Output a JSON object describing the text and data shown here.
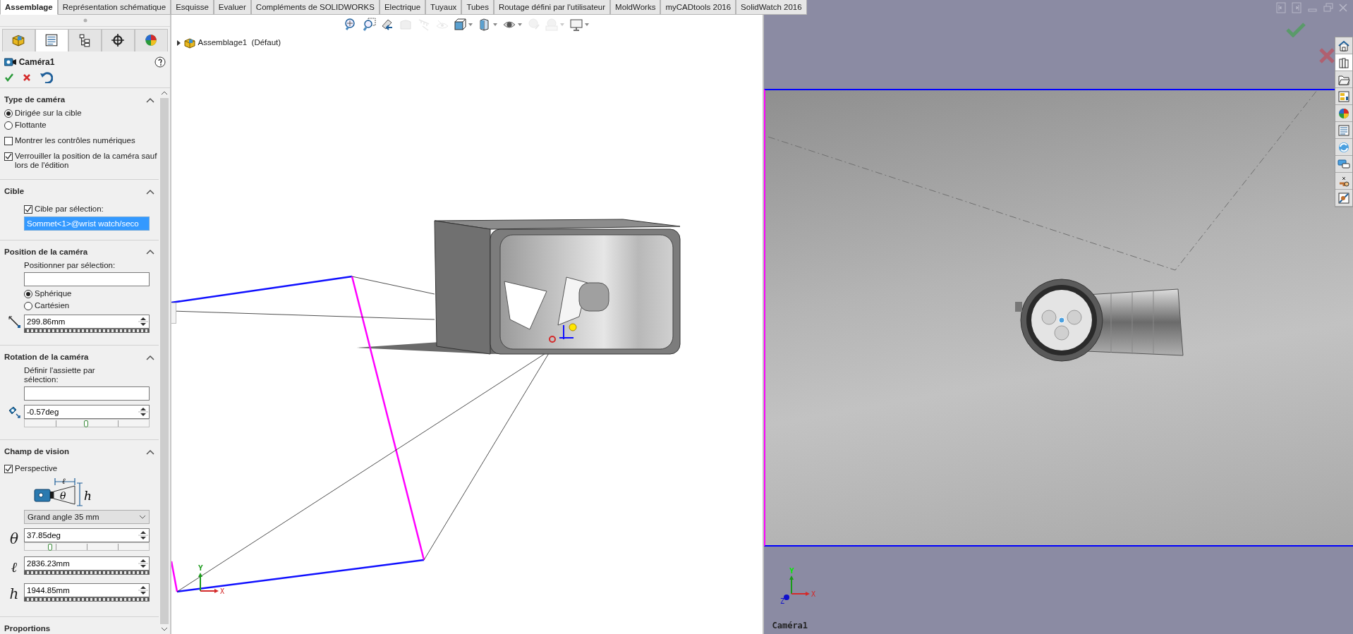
{
  "command_tabs": [
    {
      "label": "Assemblage",
      "selected": true
    },
    {
      "label": "Représentation schématique",
      "selected": false
    },
    {
      "label": "Esquisse",
      "selected": false
    },
    {
      "label": "Evaluer",
      "selected": false
    },
    {
      "label": "Compléments de SOLIDWORKS",
      "selected": false
    },
    {
      "label": "Electrique",
      "selected": false
    },
    {
      "label": "Tuyaux",
      "selected": false
    },
    {
      "label": "Tubes",
      "selected": false
    },
    {
      "label": "Routage défini par l'utilisateur",
      "selected": false
    },
    {
      "label": "MoldWorks",
      "selected": false
    },
    {
      "label": "myCADtools 2016",
      "selected": false
    },
    {
      "label": "SolidWatch 2016",
      "selected": false
    }
  ],
  "panel_tabs": [
    {
      "kind": "part",
      "selected": false
    },
    {
      "kind": "properties",
      "selected": true
    },
    {
      "kind": "config",
      "selected": false
    },
    {
      "kind": "target",
      "selected": false
    },
    {
      "kind": "appearance",
      "selected": false
    }
  ],
  "property_manager": {
    "title": "Caméra1",
    "sections": [
      {
        "title": "Type de caméra",
        "expanded": true,
        "items": [
          {
            "kind": "radio",
            "label": "Dirigée sur la cible",
            "selected": true,
            "indented": false
          },
          {
            "kind": "radio",
            "label": "Flottante",
            "selected": false,
            "indented": false
          },
          {
            "kind": "checkbox",
            "label": "Montrer les contrôles numériques",
            "checked": false,
            "indented": false
          },
          {
            "kind": "checkbox",
            "label": "Verrouiller la position de la caméra sauf lors de l'édition",
            "checked": true,
            "indented": false
          }
        ]
      },
      {
        "title": "Cible",
        "expanded": true,
        "items": [
          {
            "kind": "checkbox",
            "label": "Cible par sélection:",
            "checked": true,
            "indented": true
          },
          {
            "kind": "field",
            "value": "Sommet<1>@wrist watch/seco",
            "highlighted": true
          }
        ]
      },
      {
        "title": "Position de la caméra",
        "expanded": true,
        "items": [
          {
            "kind": "label",
            "text": "Positionner par sélection:",
            "indented": true
          },
          {
            "kind": "field",
            "highlighted": false
          },
          {
            "kind": "radio",
            "label": "Sphérique",
            "selected": true,
            "indented": true
          },
          {
            "kind": "radio",
            "label": "Cartésien",
            "selected": false,
            "indented": true
          },
          {
            "kind": "distance",
            "value": "299.86mm",
            "indented": false
          }
        ]
      },
      {
        "title": "Rotation de la caméra",
        "expanded": true,
        "items": [
          {
            "kind": "label",
            "text": "Définir l'assiette par sélection:",
            "indented": true
          },
          {
            "kind": "field",
            "highlighted": false
          },
          {
            "kind": "roll",
            "value": "-0.57deg",
            "level": 0.5,
            "indented": false
          }
        ]
      },
      {
        "title": "Champ de vision",
        "expanded": true,
        "items": [
          {
            "kind": "checkbox",
            "label": "Perspective",
            "checked": true,
            "indented": false
          },
          {
            "kind": "diagram",
            "length": "ℓ",
            "angle": "θ",
            "height": "h",
            "indented": true
          },
          {
            "kind": "select",
            "value": "Grand angle 35 mm",
            "indented": true
          },
          {
            "kind": "angle",
            "symbol": "θ",
            "value": "37.85deg",
            "level": 0.21,
            "indented": false
          },
          {
            "kind": "length",
            "symbol": "ℓ",
            "value": "2836.23mm",
            "indented": false
          },
          {
            "kind": "length",
            "symbol": "h",
            "value": "1944.85mm",
            "indented": false
          }
        ]
      },
      {
        "title": "Proportions"
      }
    ]
  },
  "viewport": {
    "toolbar": [
      {
        "kind": "zoom-fit",
        "disabled": false,
        "dropdown": false
      },
      {
        "kind": "zoom-area",
        "disabled": false,
        "dropdown": false
      },
      {
        "kind": "previous-view",
        "disabled": false,
        "dropdown": false
      },
      {
        "kind": "section",
        "disabled": true,
        "dropdown": false
      },
      {
        "kind": "annotation",
        "disabled": true,
        "dropdown": false
      },
      {
        "kind": "view-eye",
        "disabled": true,
        "dropdown": false
      },
      {
        "kind": "orientation",
        "disabled": false,
        "dropdown": true
      },
      {
        "kind": "display-style",
        "disabled": false,
        "dropdown": true
      },
      {
        "kind": "hide-show",
        "disabled": false,
        "dropdown": true
      },
      {
        "kind": "edit-appearance",
        "disabled": true,
        "dropdown": false
      },
      {
        "kind": "scene",
        "disabled": true,
        "dropdown": true
      },
      {
        "kind": "monitor",
        "disabled": false,
        "dropdown": true
      }
    ],
    "tree": {
      "label": "Assemblage1  (Défaut)",
      "expanded": false
    },
    "triad": {
      "x": "X",
      "y": "Y"
    }
  },
  "camera_view": {
    "triad": {
      "x": "X",
      "y": "Y",
      "z": "Z"
    },
    "label": "Caméra1",
    "task_pane": [
      {
        "kind": "home",
        "selected": false
      },
      {
        "kind": "library",
        "selected": true
      },
      {
        "kind": "folder",
        "selected": false
      },
      {
        "kind": "palette",
        "selected": false
      },
      {
        "kind": "appearance",
        "selected": false
      },
      {
        "kind": "properties",
        "selected": false
      },
      {
        "kind": "refresh",
        "selected": false
      },
      {
        "kind": "chat",
        "selected": false
      },
      {
        "kind": "routing",
        "selected": false
      },
      {
        "kind": "motion",
        "selected": false
      }
    ]
  }
}
